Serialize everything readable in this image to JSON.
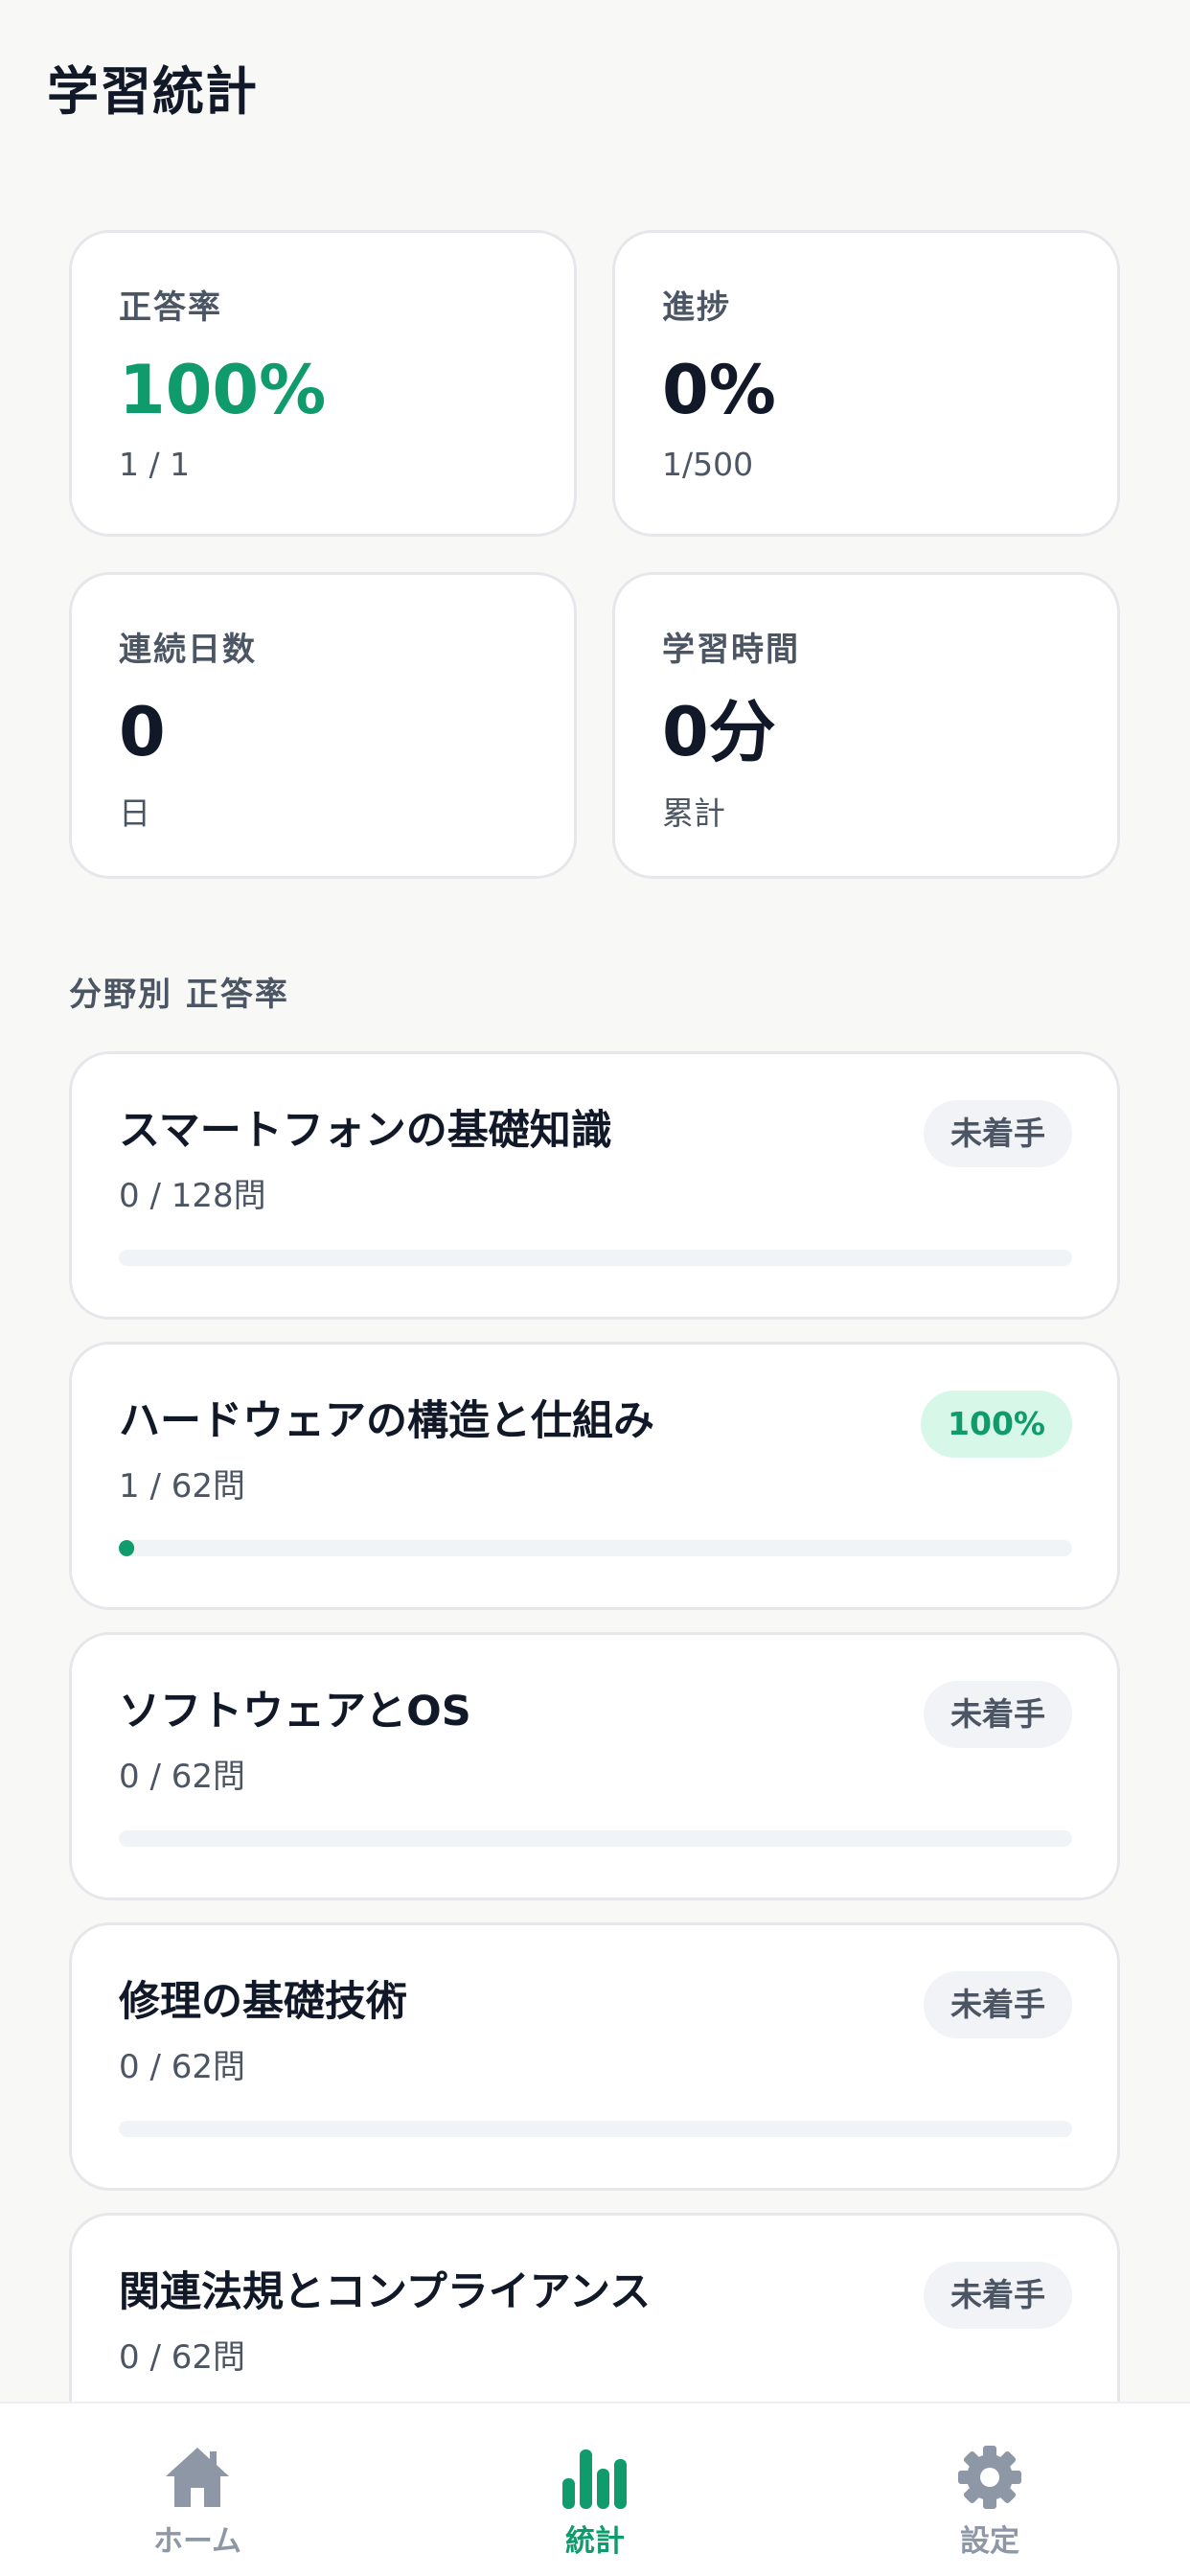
{
  "page": {
    "title": "学習統計"
  },
  "stats": [
    {
      "label": "正答率",
      "value": "100%",
      "sub": "1 / 1"
    },
    {
      "label": "進捗",
      "value": "0%",
      "sub": "1/500"
    },
    {
      "label": "連続日数",
      "value": "0",
      "sub": "日"
    },
    {
      "label": "学習時間",
      "value": "0分",
      "sub": "累計"
    }
  ],
  "section": {
    "heading": "分野別 正答率"
  },
  "categories": [
    {
      "name": "スマートフォンの基礎知識",
      "count": "0 / 128問",
      "badge": "未着手",
      "progress": 0
    },
    {
      "name": "ハードウェアの構造と仕組み",
      "count": "1 / 62問",
      "badge": "100%",
      "progress": 0.016
    },
    {
      "name": "ソフトウェアとOS",
      "count": "0 / 62問",
      "badge": "未着手",
      "progress": 0
    },
    {
      "name": "修理の基礎技術",
      "count": "0 / 62問",
      "badge": "未着手",
      "progress": 0
    },
    {
      "name": "関連法規とコンプライアンス",
      "count": "0 / 62問",
      "badge": "未着手",
      "progress": 0
    }
  ],
  "nav": {
    "items": [
      {
        "label": "ホーム",
        "icon": "home-icon"
      },
      {
        "label": "統計",
        "icon": "bar-chart-icon",
        "active": true
      },
      {
        "label": "設定",
        "icon": "gear-icon"
      }
    ]
  },
  "colors": {
    "accent": "#0f9b6c",
    "badge_done_bg": "#d7f8e8",
    "badge_pending_bg": "#f1f3f7",
    "nav_inactive": "#8e97a6"
  }
}
